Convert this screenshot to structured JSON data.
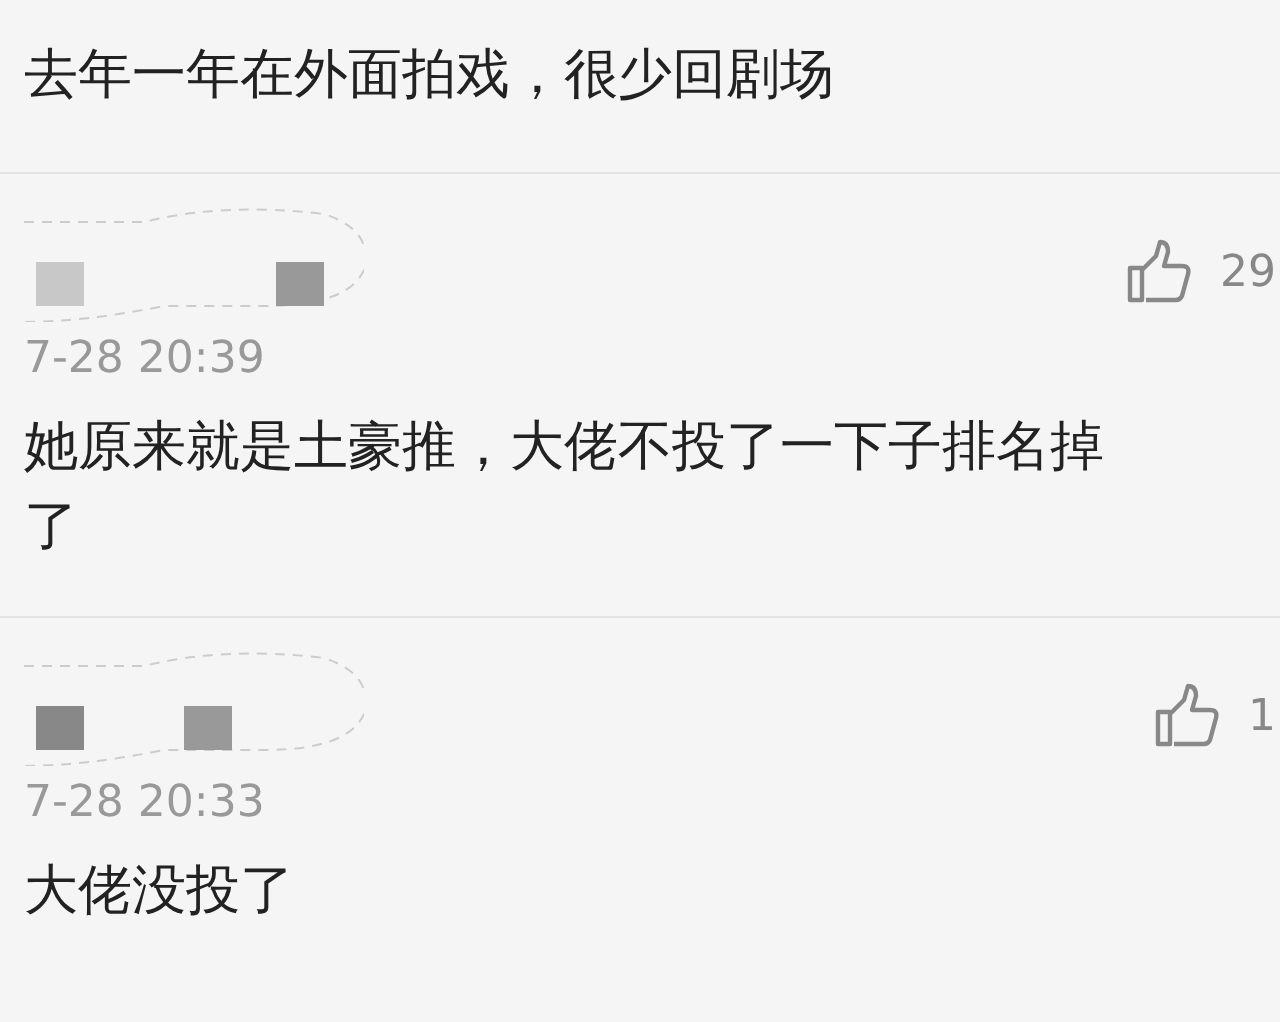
{
  "comments": [
    {
      "kind": "text",
      "text": "去年一年在外面拍戏，很少回剧场"
    },
    {
      "kind": "comment",
      "likes": "29",
      "time": "7-28 20:39",
      "text": "她原来就是土豪推，大佬不投了一下子排名掉了"
    },
    {
      "kind": "comment",
      "likes": "1",
      "time": "7-28 20:33",
      "text": "大佬没投了"
    }
  ]
}
